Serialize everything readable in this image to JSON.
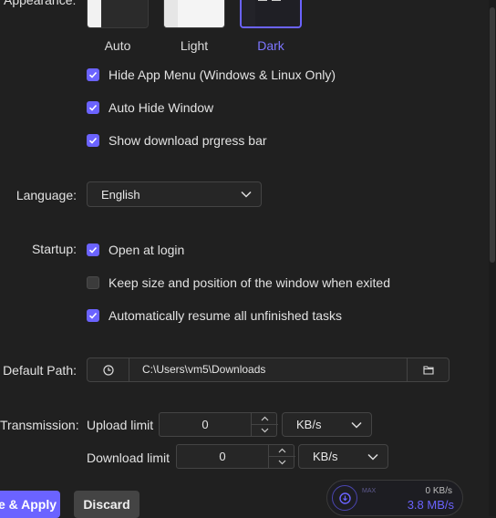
{
  "appearance": {
    "label": "Appearance:",
    "themes": [
      {
        "name": "Auto",
        "selected": false
      },
      {
        "name": "Light",
        "selected": false
      },
      {
        "name": "Dark",
        "selected": true
      }
    ]
  },
  "checkboxes": {
    "hide_menu": {
      "label": "Hide App Menu (Windows & Linux Only)",
      "checked": true
    },
    "auto_hide": {
      "label": "Auto Hide Window",
      "checked": true
    },
    "download_bar": {
      "label": "Show download prgress bar",
      "checked": true
    }
  },
  "language": {
    "label": "Language:",
    "value": "English"
  },
  "startup": {
    "label": "Startup:",
    "open_login": {
      "label": "Open at login",
      "checked": true
    },
    "keep_size": {
      "label": "Keep size and position of the window when exited",
      "checked": false
    },
    "resume": {
      "label": "Automatically resume all unfinished tasks",
      "checked": true
    }
  },
  "default_path": {
    "label": "Default Path:",
    "value": "C:\\Users\\vm5\\Downloads"
  },
  "transmission": {
    "label": "Transmission:",
    "upload": {
      "label": "Upload limit",
      "value": "0",
      "unit": "KB/s"
    },
    "download": {
      "label": "Download limit",
      "value": "0",
      "unit": "KB/s"
    }
  },
  "buttons": {
    "save_apply": "e & Apply",
    "discard": "Discard"
  },
  "speed_widget": {
    "upload": "0 KB/s",
    "download": "3.8 MB/s",
    "caption": "MAX"
  },
  "colors": {
    "accent": "#6b63ff",
    "background": "#202020"
  }
}
